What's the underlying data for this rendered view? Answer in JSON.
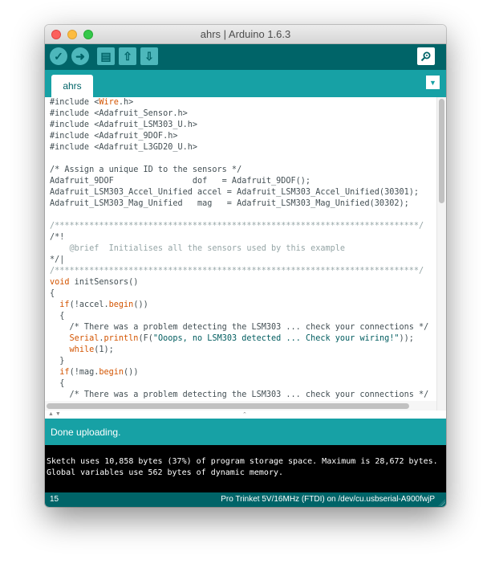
{
  "window": {
    "title": "ahrs | Arduino 1.6.3"
  },
  "toolbar": {
    "buttons": [
      {
        "name": "verify",
        "icon": "checkmark-icon",
        "glyph": "✓"
      },
      {
        "name": "upload",
        "icon": "arrow-right-icon",
        "glyph": "➜"
      },
      {
        "name": "new",
        "icon": "new-file-icon",
        "glyph": "▤"
      },
      {
        "name": "open",
        "icon": "open-arrow-up-icon",
        "glyph": "⇧"
      },
      {
        "name": "save",
        "icon": "save-arrow-down-icon",
        "glyph": "⇩"
      }
    ],
    "serial_monitor_icon": "magnifier-icon"
  },
  "tabs": {
    "active": "ahrs",
    "menu_icon": "triangle-down-icon"
  },
  "editor": {
    "lines": [
      {
        "t": "#include <",
        "s": [
          [
            "Wire",
            "kw"
          ],
          [
            ".h>",
            ""
          ]
        ]
      },
      {
        "t": "#include <Adafruit_Sensor.h>"
      },
      {
        "t": "#include <Adafruit_LSM303_U.h>"
      },
      {
        "t": "#include <Adafruit_9DOF.h>"
      },
      {
        "t": "#include <Adafruit_L3GD20_U.h>"
      },
      {
        "t": ""
      },
      {
        "t": "/* Assign a unique ID to the sensors */"
      },
      {
        "t": "Adafruit_9DOF                dof   = Adafruit_9DOF();"
      },
      {
        "t": "Adafruit_LSM303_Accel_Unified accel = Adafruit_LSM303_Accel_Unified(30301);"
      },
      {
        "t": "Adafruit_LSM303_Mag_Unified   mag   = Adafruit_LSM303_Mag_Unified(30302);"
      },
      {
        "t": ""
      },
      {
        "t": "/**************************************************************************/",
        "c": "cm"
      },
      {
        "t": "/*!"
      },
      {
        "t": "    @brief  Initialises all the sensors used by this example",
        "c": "cm"
      },
      {
        "t": "*/|"
      },
      {
        "t": "/**************************************************************************/",
        "c": "cm"
      },
      {
        "t": "",
        "s": [
          [
            "void",
            "kw"
          ],
          [
            " initSensors()",
            ""
          ]
        ]
      },
      {
        "t": "{"
      },
      {
        "t": "  ",
        "s": [
          [
            "if",
            "kw"
          ],
          [
            "(!accel.",
            ""
          ],
          [
            "begin",
            "kw"
          ],
          [
            "())",
            ""
          ]
        ]
      },
      {
        "t": "  {"
      },
      {
        "t": "    /* There was a problem detecting the LSM303 ... check your connections */"
      },
      {
        "t": "    ",
        "s": [
          [
            "Serial",
            "kw"
          ],
          [
            ".",
            ""
          ],
          [
            "println",
            "kw"
          ],
          [
            "(F(",
            ""
          ],
          [
            "\"Ooops, no LSM303 detected ... Check your wiring!\"",
            "str"
          ],
          [
            "));",
            ""
          ]
        ]
      },
      {
        "t": "    ",
        "s": [
          [
            "while",
            "kw"
          ],
          [
            "(1);",
            ""
          ]
        ]
      },
      {
        "t": "  }"
      },
      {
        "t": "  ",
        "s": [
          [
            "if",
            "kw"
          ],
          [
            "(!mag.",
            ""
          ],
          [
            "begin",
            "kw"
          ],
          [
            "())",
            ""
          ]
        ]
      },
      {
        "t": "  {"
      },
      {
        "t": "    /* There was a problem detecting the LSM303 ... check your connections */"
      }
    ]
  },
  "status": {
    "message": "Done uploading."
  },
  "console": {
    "lines": [
      "Sketch uses 10,858 bytes (37%) of program storage space. Maximum is 28,672 bytes.",
      "Global variables use 562 bytes of dynamic memory."
    ]
  },
  "footer": {
    "line_number": "15",
    "board_port": "Pro Trinket 5V/16MHz (FTDI) on /dev/cu.usbserial-A900fwjP"
  },
  "colors": {
    "toolbar": "#006468",
    "tabbar": "#17a1a5",
    "keyword": "#d35400",
    "console_bg": "#000000"
  }
}
